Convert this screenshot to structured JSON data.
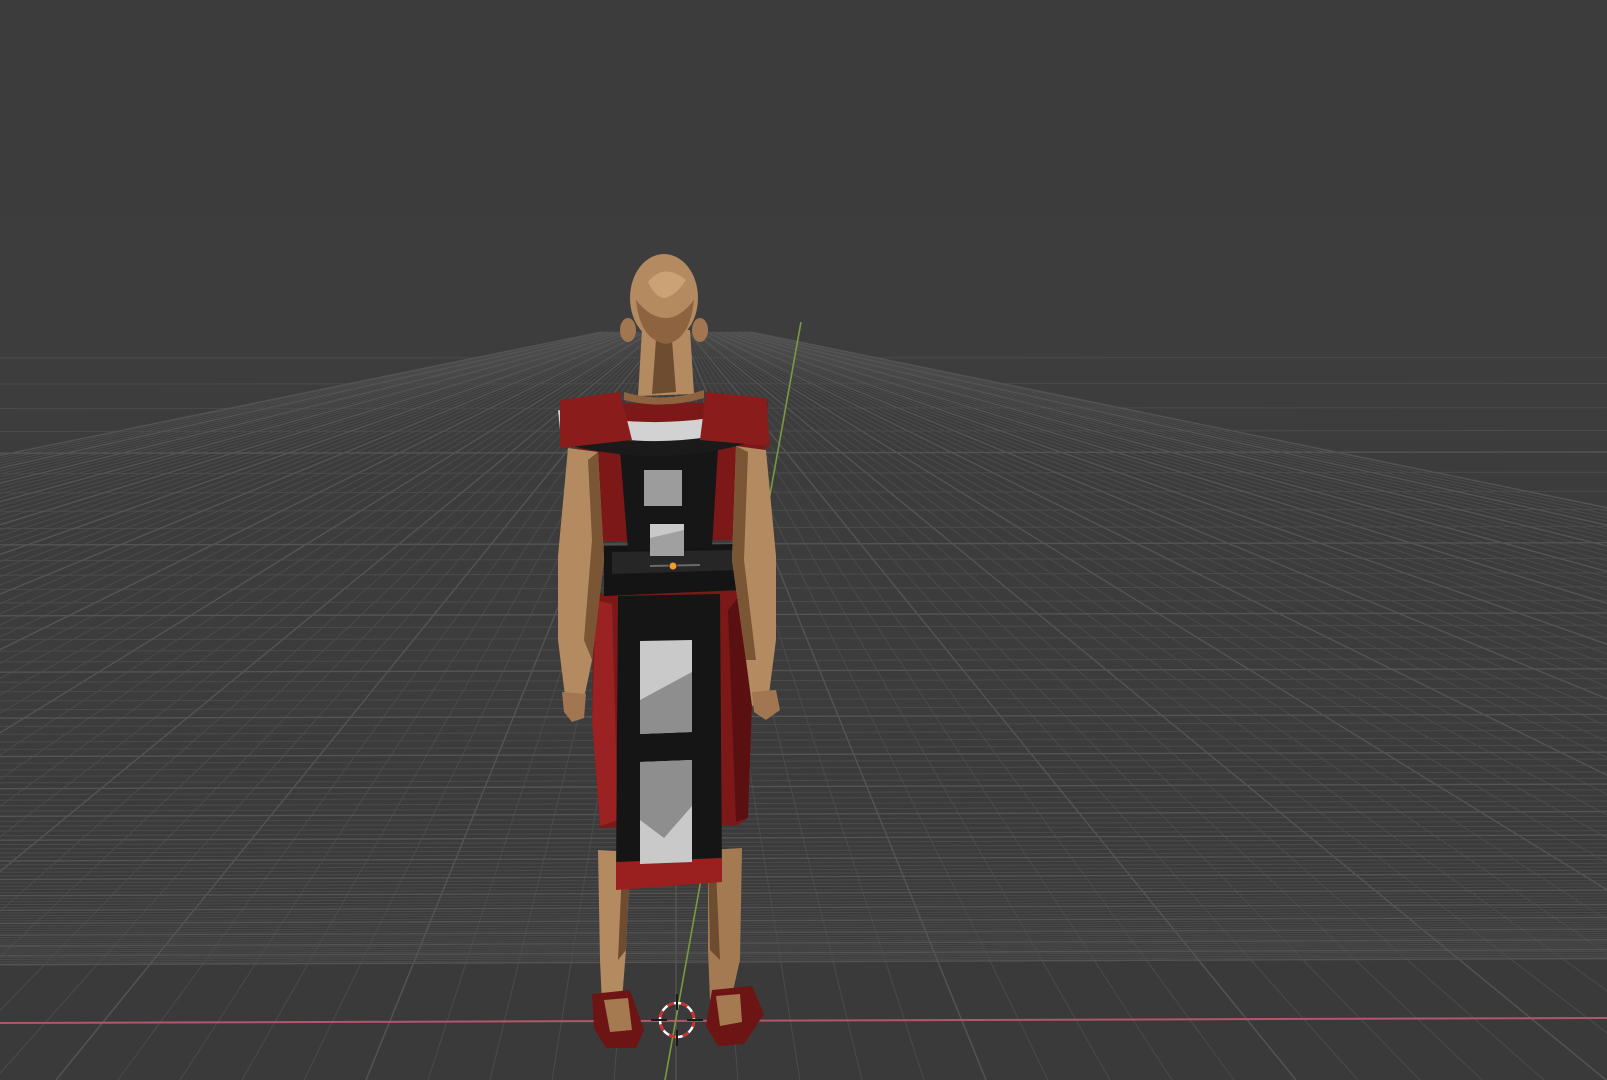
{
  "viewport": {
    "kind": "3D viewport",
    "shading": "solid",
    "background_color": "#3d3d3d",
    "grid_color": "#4d4d4d",
    "x_axis_color": "#b3566a",
    "y_axis_color": "#7a9a3e"
  },
  "scene": {
    "character_view": "back",
    "colors": {
      "skin": "#b48a60",
      "skin_shadow": "#6e4c30",
      "robe_red": "#7c1818",
      "robe_red_light": "#9a2222",
      "robe_black": "#151515",
      "panel_light": "#c9c9c9",
      "panel_gray": "#8e8e8e"
    }
  },
  "gizmos": {
    "origin_icon": "origin-dot-icon",
    "cursor_icon": "3d-cursor-icon"
  }
}
